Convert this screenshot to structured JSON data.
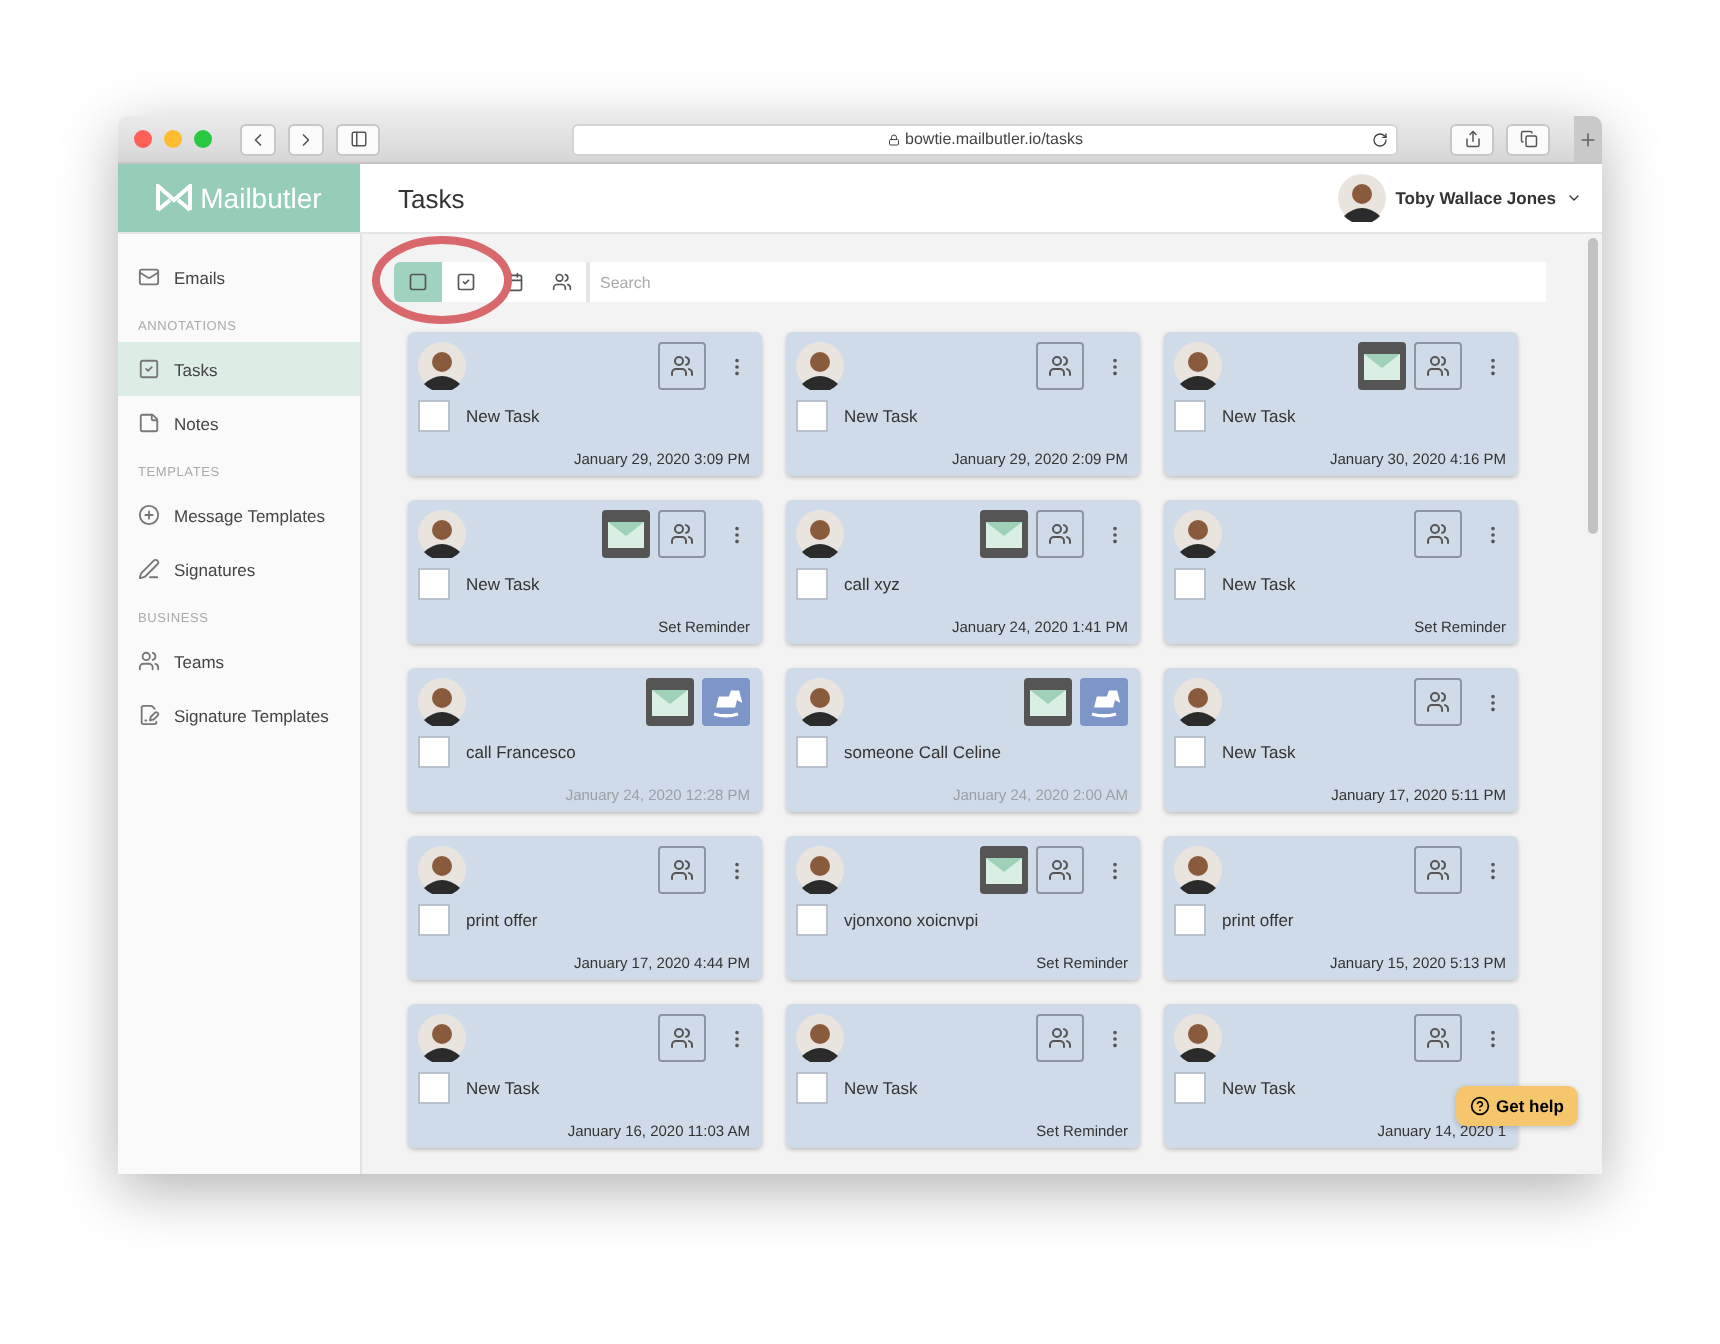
{
  "browser": {
    "url": "bowtie.mailbutler.io/tasks"
  },
  "app": {
    "logo": "Mailbutler",
    "title": "Tasks",
    "user": "Toby Wallace Jones"
  },
  "sidebar": {
    "items": [
      {
        "kind": "item",
        "label": "Emails",
        "selected": false
      },
      {
        "kind": "heading",
        "label": "ANNOTATIONS"
      },
      {
        "kind": "item",
        "label": "Tasks",
        "selected": true
      },
      {
        "kind": "item",
        "label": "Notes",
        "selected": false
      },
      {
        "kind": "heading",
        "label": "TEMPLATES"
      },
      {
        "kind": "item",
        "label": "Message Templates",
        "selected": false
      },
      {
        "kind": "item",
        "label": "Signatures",
        "selected": false
      },
      {
        "kind": "heading",
        "label": "BUSINESS"
      },
      {
        "kind": "item",
        "label": "Teams",
        "selected": false
      },
      {
        "kind": "item",
        "label": "Signature Templates",
        "selected": false
      }
    ]
  },
  "toolbar": {
    "views": [
      {
        "selected": true
      },
      {
        "selected": false
      },
      {
        "selected": false
      },
      {
        "selected": false
      }
    ],
    "search": {
      "placeholder": "Search"
    }
  },
  "cards": [
    {
      "mail": false,
      "horse": false,
      "team": true,
      "menu": true,
      "checked": false,
      "title": "New Task",
      "date": "January 29, 2020 3:09 PM",
      "dimmed": false
    },
    {
      "mail": false,
      "horse": false,
      "team": true,
      "menu": true,
      "checked": false,
      "title": "New Task",
      "date": "January 29, 2020 2:09 PM",
      "dimmed": false
    },
    {
      "mail": true,
      "horse": false,
      "team": true,
      "menu": true,
      "checked": false,
      "title": "New Task",
      "date": "January 30, 2020 4:16 PM",
      "dimmed": false
    },
    {
      "mail": true,
      "horse": false,
      "team": true,
      "menu": true,
      "checked": false,
      "title": "New Task",
      "date": "Set Reminder",
      "dimmed": false
    },
    {
      "mail": true,
      "horse": false,
      "team": true,
      "menu": true,
      "checked": false,
      "title": "call xyz",
      "date": "January 24, 2020 1:41 PM",
      "dimmed": false
    },
    {
      "mail": false,
      "horse": false,
      "team": true,
      "menu": true,
      "checked": false,
      "title": "New Task",
      "date": "Set Reminder",
      "dimmed": false
    },
    {
      "mail": true,
      "horse": true,
      "team": false,
      "menu": false,
      "checked": false,
      "title": "call Francesco",
      "date": "January 24, 2020 12:28 PM",
      "dimmed": true
    },
    {
      "mail": true,
      "horse": true,
      "team": false,
      "menu": false,
      "checked": false,
      "title": "someone Call Celine",
      "date": "January 24, 2020 2:00 AM",
      "dimmed": true
    },
    {
      "mail": false,
      "horse": false,
      "team": true,
      "menu": true,
      "checked": false,
      "title": "New Task",
      "date": "January 17, 2020 5:11 PM",
      "dimmed": false
    },
    {
      "mail": false,
      "horse": false,
      "team": true,
      "menu": true,
      "checked": false,
      "title": "print offer",
      "date": "January 17, 2020 4:44 PM",
      "dimmed": false
    },
    {
      "mail": true,
      "horse": false,
      "team": true,
      "menu": true,
      "checked": false,
      "title": "vjonxono xoicnvpi",
      "date": "Set Reminder",
      "dimmed": false
    },
    {
      "mail": false,
      "horse": false,
      "team": true,
      "menu": true,
      "checked": false,
      "title": "print offer",
      "date": "January 15, 2020 5:13 PM",
      "dimmed": false
    },
    {
      "mail": false,
      "horse": false,
      "team": true,
      "menu": true,
      "checked": false,
      "title": "New Task",
      "date": "January 16, 2020 11:03 AM",
      "dimmed": false
    },
    {
      "mail": false,
      "horse": false,
      "team": true,
      "menu": true,
      "checked": false,
      "title": "New Task",
      "date": "Set Reminder",
      "dimmed": false
    },
    {
      "mail": false,
      "horse": false,
      "team": true,
      "menu": true,
      "checked": false,
      "title": "New Task",
      "date": "January 14, 2020 1",
      "dimmed": false
    }
  ],
  "help_button": {
    "label": "Get help"
  }
}
